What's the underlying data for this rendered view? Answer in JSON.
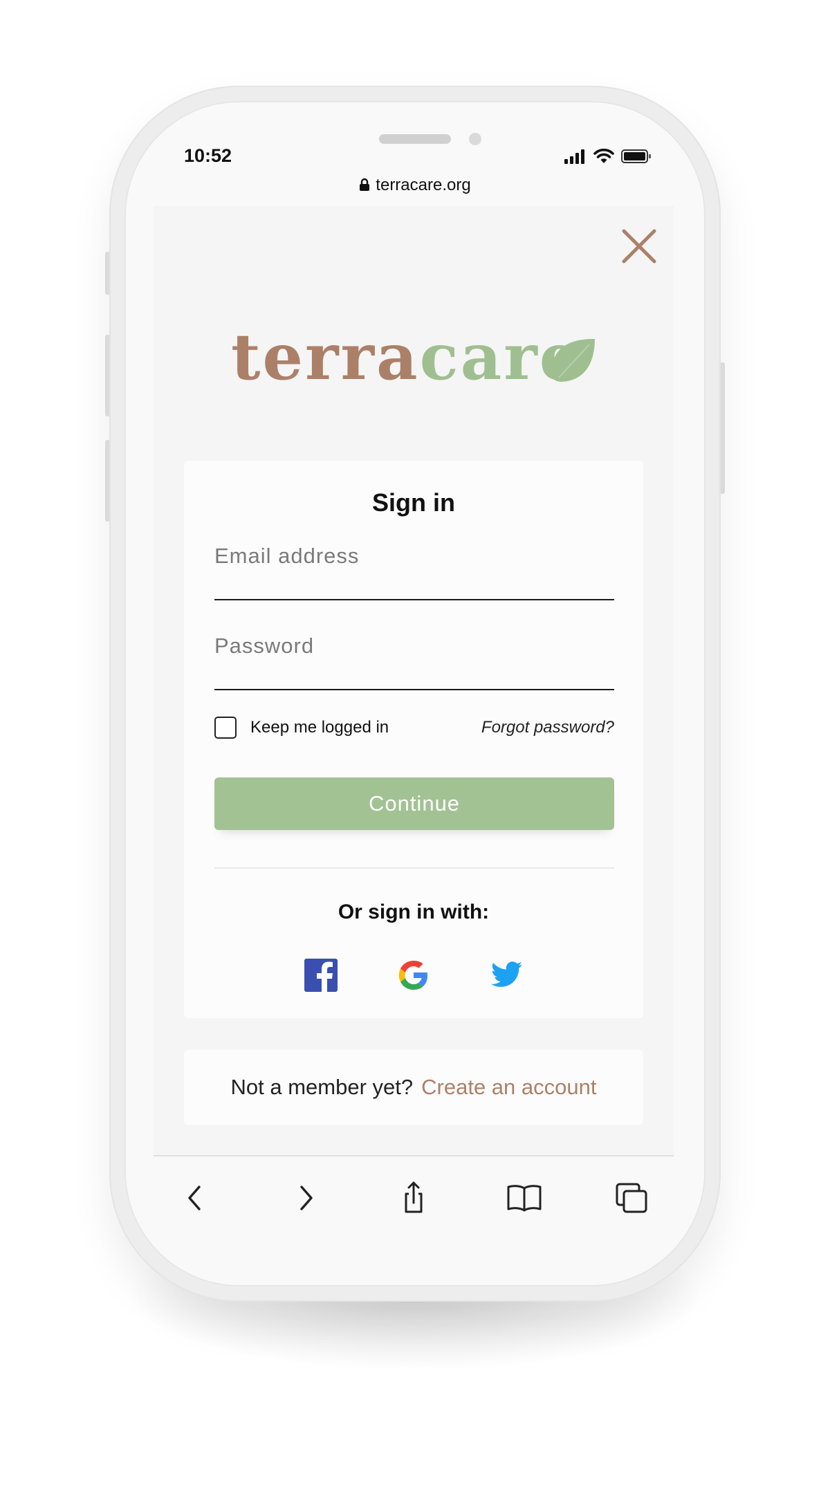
{
  "status_bar": {
    "time": "10:52"
  },
  "browser": {
    "url": "terracare.org"
  },
  "logo": {
    "part1": "terra",
    "part2": "care"
  },
  "signin": {
    "title": "Sign in",
    "email_placeholder": "Email address",
    "email_value": "",
    "password_placeholder": "Password",
    "password_value": "",
    "keep_logged_in_label": "Keep me logged in",
    "keep_logged_in_checked": false,
    "forgot_password": "Forgot password?",
    "continue_label": "Continue",
    "or_sign_in_with": "Or sign in with:",
    "social": [
      "facebook-icon",
      "google-icon",
      "twitter-icon"
    ]
  },
  "register": {
    "prompt": "Not a member yet?",
    "link": "Create an account"
  },
  "toolbar": {
    "icons": [
      "back-icon",
      "forward-icon",
      "share-icon",
      "bookmarks-icon",
      "tabs-icon"
    ]
  },
  "colors": {
    "brown": "#ac8068",
    "green": "#a0bf91",
    "button": "#a3c294",
    "facebook": "#3b4fb0",
    "twitter": "#1da1f2"
  }
}
